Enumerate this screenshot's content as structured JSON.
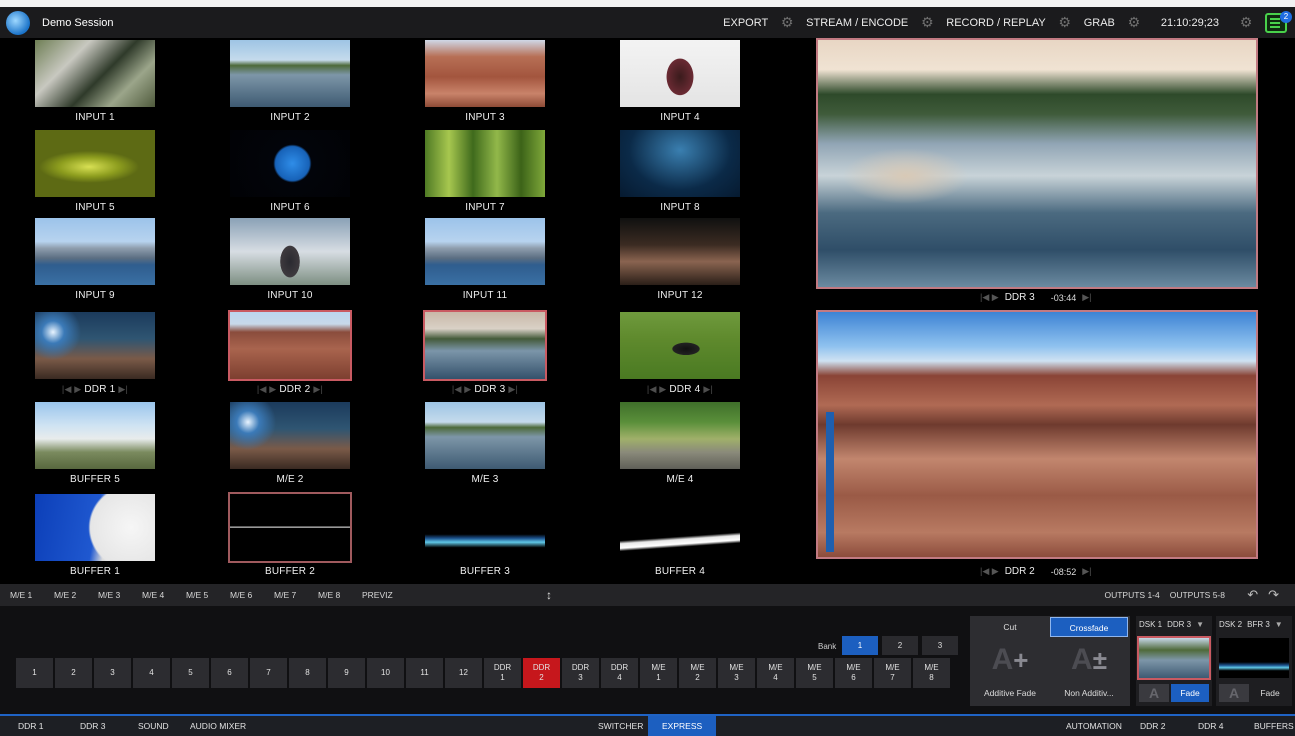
{
  "topbar": {
    "session_title": "Demo Session",
    "menu": [
      "EXPORT",
      "STREAM / ENCODE",
      "RECORD / REPLAY",
      "GRAB"
    ],
    "timecode": "21:10:29;23",
    "notification_count": "2"
  },
  "monitors": {
    "input_1": "INPUT 1",
    "input_2": "INPUT 2",
    "input_3": "INPUT 3",
    "input_4": "INPUT 4",
    "input_5": "INPUT 5",
    "input_6": "INPUT 6",
    "input_7": "INPUT 7",
    "input_8": "INPUT 8",
    "input_9": "INPUT 9",
    "input_10": "INPUT 10",
    "input_11": "INPUT 11",
    "input_12": "INPUT 12",
    "ddr_1": "DDR 1",
    "ddr_2": "DDR 2",
    "ddr_3": "DDR 3",
    "ddr_4": "DDR 4",
    "buffer_5": "BUFFER 5",
    "me_2": "M/E 2",
    "me_3": "M/E 3",
    "me_4": "M/E 4",
    "buffer_1": "BUFFER 1",
    "buffer_2": "BUFFER 2",
    "buffer_3": "BUFFER 3",
    "buffer_4": "BUFFER 4"
  },
  "outputs": {
    "program_source": "DDR 3",
    "program_time": "-03:44",
    "preview_source": "DDR 2",
    "preview_time": "-08:52"
  },
  "me_tabs": [
    "M/E 1",
    "M/E 2",
    "M/E 3",
    "M/E 4",
    "M/E 5",
    "M/E 6",
    "M/E 7",
    "M/E 8",
    "PREVIZ"
  ],
  "output_tabs": [
    "OUTPUTS 1-4",
    "OUTPUTS 5-8"
  ],
  "switcher": {
    "bank_label": "Bank",
    "banks": [
      "1",
      "2",
      "3"
    ],
    "sources": [
      "1",
      "2",
      "3",
      "4",
      "5",
      "6",
      "7",
      "8",
      "9",
      "10",
      "11",
      "12",
      "DDR\n1",
      "DDR\n2",
      "DDR\n3",
      "DDR\n4",
      "M/E\n1",
      "M/E\n2",
      "M/E\n3",
      "M/E\n4",
      "M/E\n5",
      "M/E\n6",
      "M/E\n7",
      "M/E\n8"
    ],
    "active_source": "DDR\n2"
  },
  "transition": {
    "cut": "Cut",
    "crossfade": "Crossfade",
    "additive_fade": "Additive Fade",
    "non_additive": "Non Additiv..."
  },
  "dsk": {
    "dsk1_label": "DSK 1",
    "dsk1_source": "DDR 3",
    "dsk1_fade": "Fade",
    "dsk2_label": "DSK 2",
    "dsk2_source": "BFR 3",
    "dsk2_fade": "Fade"
  },
  "bottom_tabs": {
    "ddr1": "DDR 1",
    "ddr3": "DDR 3",
    "sound": "SOUND",
    "audio_mixer": "AUDIO MIXER",
    "switcher": "SWITCHER",
    "express": "EXPRESS",
    "automation": "AUTOMATION",
    "ddr2": "DDR 2",
    "ddr4": "DDR 4",
    "buffers": "BUFFERS"
  },
  "colors": {
    "accent": "#1c5fc0",
    "tally_red": "#c6171c",
    "selection": "#c95a62"
  }
}
